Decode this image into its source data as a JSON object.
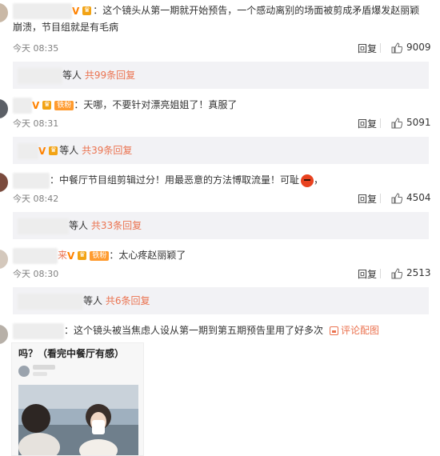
{
  "comments": [
    {
      "text": "：这个镜头从第一期就开始预告，一个感动离别的场面被剪成矛盾爆发赵丽颖崩溃，节目组就是有毛病",
      "time": "今天 08:35",
      "reply": "回复",
      "likes": "9009",
      "sub": {
        "suffix": "等人",
        "count": "共99条回复"
      }
    },
    {
      "badge": "铁粉",
      "text": "：天哪，不要针对漂亮姐姐了！真服了",
      "time": "今天 08:31",
      "reply": "回复",
      "likes": "5091",
      "sub": {
        "suffix": "等人",
        "count": "共39条回复"
      }
    },
    {
      "text": "：中餐厅节目组剪辑过分！用最恶意的方法博取流量！可耻",
      "trail": "，",
      "time": "今天 08:42",
      "reply": "回复",
      "likes": "4504",
      "sub": {
        "suffix": "等人",
        "count": "共33条回复"
      }
    },
    {
      "name_tail": "来",
      "badge": "铁粉",
      "text": "：太心疼赵丽颖了",
      "time": "今天 08:30",
      "reply": "回复",
      "likes": "2513",
      "sub": {
        "suffix": "等人",
        "count": "共6条回复"
      }
    },
    {
      "text": "：这个镜头被当焦虑人设从第一期到第五期预告里用了好多次",
      "comment_image_link": "评论配图",
      "image_title": "吗？（看完中餐厅有感）"
    }
  ],
  "colors": {
    "accent": "#eb7350",
    "subreply_bg": "#f2f2f5",
    "time": "#808080"
  }
}
